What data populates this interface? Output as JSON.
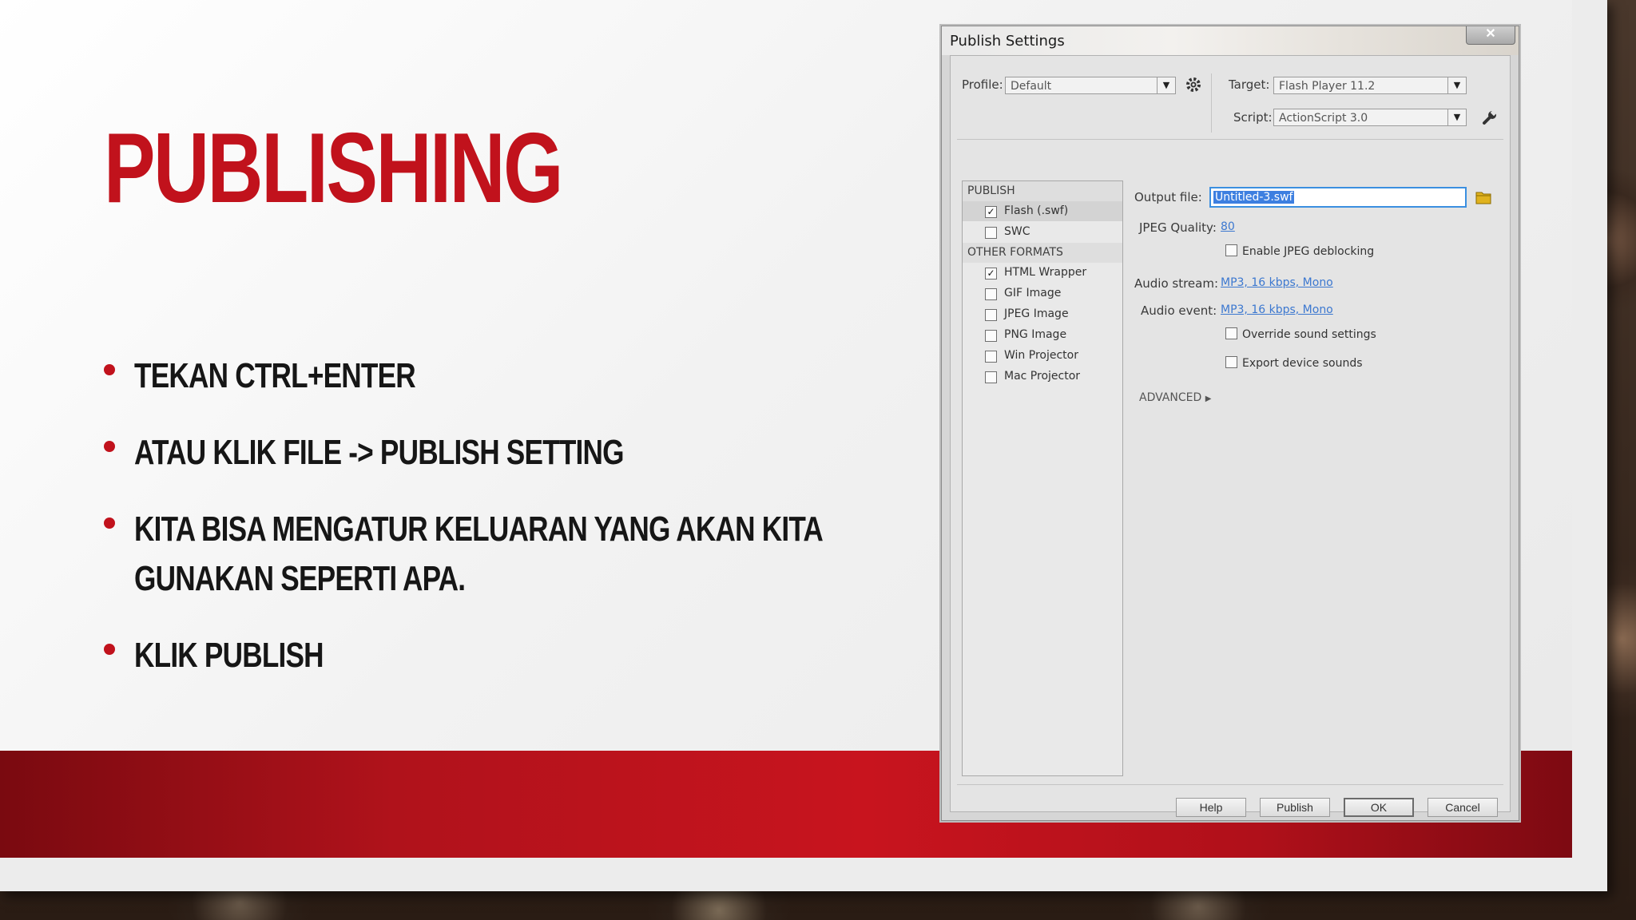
{
  "slide": {
    "title": "PUBLISHING",
    "bullets": [
      "TEKAN CTRL+ENTER",
      "ATAU KLIK FILE -> PUBLISH SETTING",
      "KITA BISA MENGATUR KELUARAN YANG AKAN KITA GUNAKAN SEPERTI APA.",
      "KLIK PUBLISH"
    ]
  },
  "dialog": {
    "title": "Publish Settings",
    "close_glyph": "✕",
    "profile_label": "Profile:",
    "profile_value": "Default",
    "target_label": "Target:",
    "target_value": "Flash Player 11.2",
    "script_label": "Script:",
    "script_value": "ActionScript 3.0",
    "publish_header": "PUBLISH",
    "publish_items": [
      {
        "label": "Flash (.swf)",
        "checked": true
      },
      {
        "label": "SWC",
        "checked": false
      }
    ],
    "other_header": "OTHER FORMATS",
    "other_items": [
      {
        "label": "HTML Wrapper",
        "checked": true
      },
      {
        "label": "GIF Image",
        "checked": false
      },
      {
        "label": "JPEG Image",
        "checked": false
      },
      {
        "label": "PNG Image",
        "checked": false
      },
      {
        "label": "Win Projector",
        "checked": false
      },
      {
        "label": "Mac Projector",
        "checked": false
      }
    ],
    "output_label": "Output file:",
    "output_value": "Untitled-3.swf",
    "jpeg_label": "JPEG Quality:",
    "jpeg_value": "80",
    "enable_deblock": "Enable JPEG deblocking",
    "audio_stream_label": "Audio stream:",
    "audio_stream_value": "MP3, 16 kbps, Mono",
    "audio_event_label": "Audio event:",
    "audio_event_value": "MP3, 16 kbps, Mono",
    "override_sound": "Override sound settings",
    "export_device": "Export device sounds",
    "advanced_label": "ADVANCED",
    "buttons": {
      "help": "Help",
      "publish": "Publish",
      "ok": "OK",
      "cancel": "Cancel"
    },
    "icons": {
      "gear": "gear-icon",
      "wrench": "wrench-icon",
      "folder": "folder-icon",
      "check": "✓",
      "dropdown": "▼",
      "expand": "▶"
    }
  }
}
